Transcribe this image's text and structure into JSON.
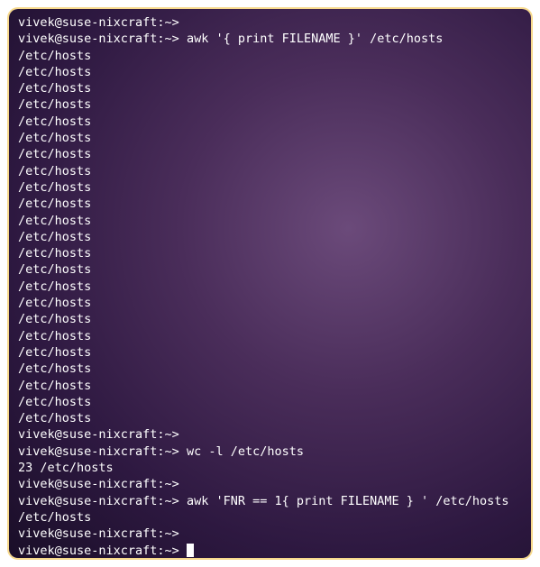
{
  "terminal": {
    "prompt": "vivek@suse-nixcraft:~>",
    "lines": [
      {
        "type": "prompt",
        "command": ""
      },
      {
        "type": "prompt",
        "command": "awk '{ print FILENAME }' /etc/hosts"
      },
      {
        "type": "output",
        "text": "/etc/hosts"
      },
      {
        "type": "output",
        "text": "/etc/hosts"
      },
      {
        "type": "output",
        "text": "/etc/hosts"
      },
      {
        "type": "output",
        "text": "/etc/hosts"
      },
      {
        "type": "output",
        "text": "/etc/hosts"
      },
      {
        "type": "output",
        "text": "/etc/hosts"
      },
      {
        "type": "output",
        "text": "/etc/hosts"
      },
      {
        "type": "output",
        "text": "/etc/hosts"
      },
      {
        "type": "output",
        "text": "/etc/hosts"
      },
      {
        "type": "output",
        "text": "/etc/hosts"
      },
      {
        "type": "output",
        "text": "/etc/hosts"
      },
      {
        "type": "output",
        "text": "/etc/hosts"
      },
      {
        "type": "output",
        "text": "/etc/hosts"
      },
      {
        "type": "output",
        "text": "/etc/hosts"
      },
      {
        "type": "output",
        "text": "/etc/hosts"
      },
      {
        "type": "output",
        "text": "/etc/hosts"
      },
      {
        "type": "output",
        "text": "/etc/hosts"
      },
      {
        "type": "output",
        "text": "/etc/hosts"
      },
      {
        "type": "output",
        "text": "/etc/hosts"
      },
      {
        "type": "output",
        "text": "/etc/hosts"
      },
      {
        "type": "output",
        "text": "/etc/hosts"
      },
      {
        "type": "output",
        "text": "/etc/hosts"
      },
      {
        "type": "output",
        "text": "/etc/hosts"
      },
      {
        "type": "prompt",
        "command": ""
      },
      {
        "type": "prompt",
        "command": "wc -l /etc/hosts"
      },
      {
        "type": "output",
        "text": "23 /etc/hosts"
      },
      {
        "type": "prompt",
        "command": ""
      },
      {
        "type": "prompt",
        "command": "awk 'FNR == 1{ print FILENAME } ' /etc/hosts"
      },
      {
        "type": "output",
        "text": "/etc/hosts"
      },
      {
        "type": "prompt",
        "command": ""
      },
      {
        "type": "prompt",
        "command": "",
        "cursor": true
      }
    ]
  }
}
